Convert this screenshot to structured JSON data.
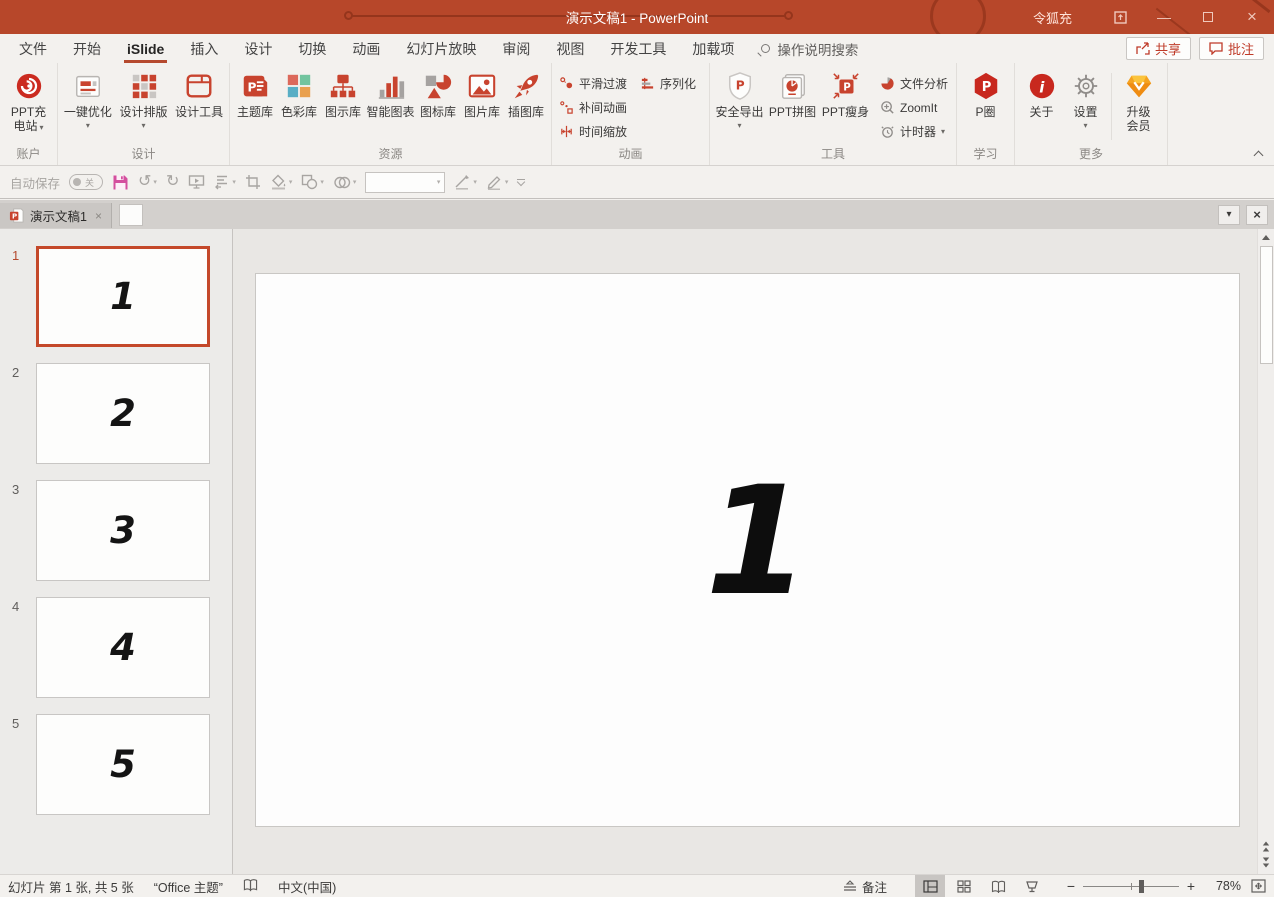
{
  "titlebar": {
    "title": "演示文稿1  -  PowerPoint",
    "user": "令狐充"
  },
  "tabs": [
    "文件",
    "开始",
    "iSlide",
    "插入",
    "设计",
    "切换",
    "动画",
    "幻灯片放映",
    "审阅",
    "视图",
    "开发工具",
    "加载项"
  ],
  "search": {
    "label": "操作说明搜索"
  },
  "actions": {
    "share": "共享",
    "comments": "批注"
  },
  "ribbon": {
    "account": {
      "group": "账户",
      "charge1": "PPT充",
      "charge2": "电站"
    },
    "design": {
      "group": "设计",
      "optimize": "一键优化",
      "layout": "设计排版",
      "tools": "设计工具"
    },
    "resources": {
      "group": "资源",
      "theme": "主题库",
      "color": "色彩库",
      "diagram": "图示库",
      "chart": "智能图表",
      "icon": "图标库",
      "picture": "图片库",
      "illustration": "插图库"
    },
    "animation": {
      "group": "动画",
      "smooth": "平滑过渡",
      "serialize": "序列化",
      "tween": "补间动画",
      "timescale": "时间缩放"
    },
    "tools": {
      "group": "工具",
      "export": "安全导出",
      "puzzle": "PPT拼图",
      "slim": "PPT瘦身",
      "analysis": "文件分析",
      "zoomit": "ZoomIt",
      "timer": "计时器"
    },
    "learn": {
      "group": "学习",
      "pcircle": "P圈"
    },
    "more": {
      "group": "更多",
      "about": "关于",
      "settings": "设置",
      "upgrade1": "升级",
      "upgrade2": "会员"
    }
  },
  "qat": {
    "autosave": "自动保存",
    "state": "关"
  },
  "doctab": {
    "name": "演示文稿1"
  },
  "slides": [
    {
      "num": "1"
    },
    {
      "num": "2"
    },
    {
      "num": "3"
    },
    {
      "num": "4"
    },
    {
      "num": "5"
    }
  ],
  "slide_view": {
    "content": "1"
  },
  "status": {
    "slide_info": "幻灯片 第 1 张, 共 5 张",
    "theme": "“Office 主题”",
    "language": "中文(中国)",
    "notes": "备注",
    "zoom": "78%"
  },
  "colors": {
    "brand": "#b7472a",
    "icon_red": "#c8432e",
    "accent_underline": "#b5492e",
    "save_pink": "#d44f9e"
  }
}
